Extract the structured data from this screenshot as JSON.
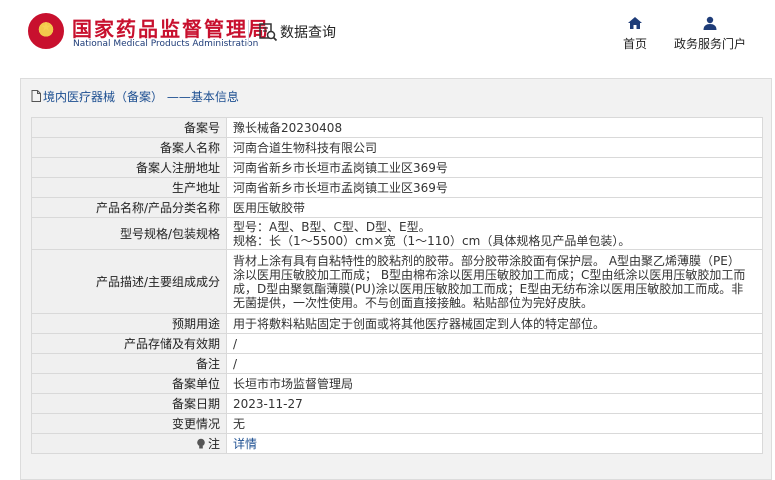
{
  "header": {
    "brand_cn": "国家药品监督管理局",
    "brand_en": "National Medical Products Administration",
    "query_label": "数据查询",
    "nav": [
      {
        "label": "首页",
        "icon": "home-icon"
      },
      {
        "label": "政务服务门户",
        "icon": "user-icon"
      }
    ]
  },
  "colors": {
    "brand_red": "#c8102e",
    "brand_blue": "#1e3c78",
    "link_blue": "#1d4f91"
  },
  "panel": {
    "title": "境内医疗器械（备案） ——基本信息",
    "rows": [
      {
        "label": "备案号",
        "value": "豫长械备20230408"
      },
      {
        "label": "备案人名称",
        "value": "河南合道生物科技有限公司"
      },
      {
        "label": "备案人注册地址",
        "value": "河南省新乡市长垣市孟岗镇工业区369号"
      },
      {
        "label": "生产地址",
        "value": "河南省新乡市长垣市孟岗镇工业区369号"
      },
      {
        "label": "产品名称/产品分类名称",
        "value": "医用压敏胶带"
      },
      {
        "label": "型号规格/包装规格",
        "lines": [
          "型号：A型、B型、C型、D型、E型。",
          "规格：长（1～5500）cm×宽（1～110）cm（具体规格见产品单包装）。"
        ]
      },
      {
        "label": "产品描述/主要组成成分",
        "lines": [
          "背材上涂有具有自粘特性的胶粘剂的胶带。部分胶带涂胶面有保护层。 A型由聚乙烯薄膜（PE）",
          "涂以医用压敏胶加工而成； B型由棉布涂以医用压敏胶加工而成；C型由纸涂以医用压敏胶加工而",
          "成，D型由聚氨酯薄膜(PU)涂以医用压敏胶加工而成；E型由无纺布涂以医用压敏胶加工而成。非",
          "无菌提供，一次性使用。不与创面直接接触。粘贴部位为完好皮肤。"
        ]
      },
      {
        "label": "预期用途",
        "value": "用于将敷料粘贴固定于创面或将其他医疗器械固定到人体的特定部位。"
      },
      {
        "label": "产品存储及有效期",
        "value": "/"
      },
      {
        "label": "备注",
        "value": "/"
      },
      {
        "label": "备案单位",
        "value": "长垣市市场监督管理局"
      },
      {
        "label": "备案日期",
        "value": "2023-11-27"
      },
      {
        "label": "变更情况",
        "value": "无"
      },
      {
        "label": "注",
        "value": "详情"
      }
    ]
  }
}
